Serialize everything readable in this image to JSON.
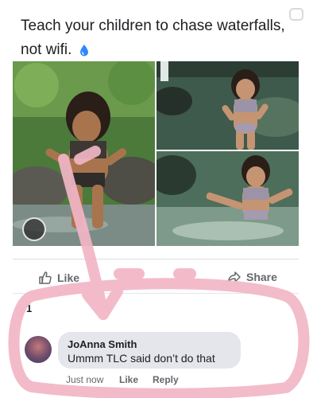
{
  "post": {
    "text": "Teach your children to chase waterfalls, not wifi.",
    "emoji_icon": "droplet-icon"
  },
  "actions": {
    "like_label": "Like",
    "share_label": "Share"
  },
  "reactions": {
    "count": "1"
  },
  "comment": {
    "author": "JoAnna Smith",
    "text": "Ummm TLC said don’t do that",
    "time": "Just now",
    "like_label": "Like",
    "reply_label": "Reply"
  },
  "colors": {
    "annotation_pink": "#f2b6c6",
    "bubble": "#e4e6eb",
    "meta_text": "#65676b"
  }
}
